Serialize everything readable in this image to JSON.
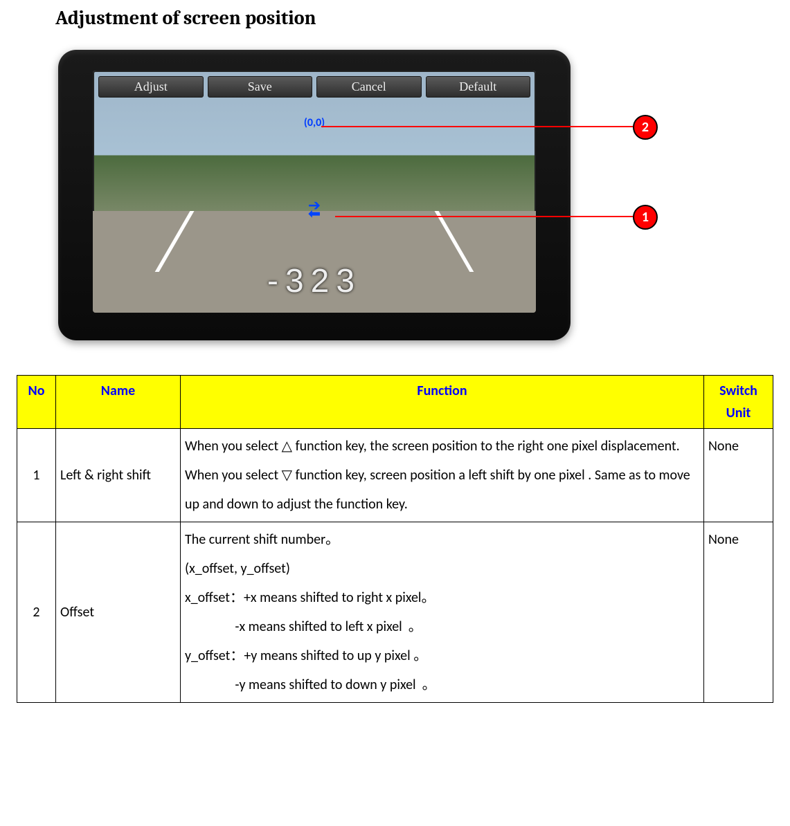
{
  "title": "Adjustment of screen position",
  "device": {
    "buttons": [
      "Adjust",
      "Save",
      "Cancel",
      "Default"
    ],
    "coord_label": "(0,0)",
    "road_number": "-323",
    "callouts": {
      "c1": "1",
      "c2": "2"
    }
  },
  "table": {
    "headers": {
      "no": "No",
      "name": "Name",
      "func": "Function",
      "switch": "Switch Unit"
    },
    "rows": [
      {
        "no": "1",
        "name": "Left & right shift",
        "func_lines": [
          "When you select  △  function key, the screen position to the right one pixel displacement.",
          "When you select  ▽  function key, screen position a left shift by one pixel . Same as to move up and down to adjust the function key."
        ],
        "switch": "None"
      },
      {
        "no": "2",
        "name": "Offset",
        "func_lines": [
          "The current shift number。",
          "(x_offset, y_offset)",
          "x_offset：+x means shifted to right x pixel。",
          "                -x means shifted to left x pixel  。",
          "y_offset：+y means shifted to up y pixel  。",
          "                -y means shifted to down y pixel  。"
        ],
        "switch": "None"
      }
    ]
  }
}
